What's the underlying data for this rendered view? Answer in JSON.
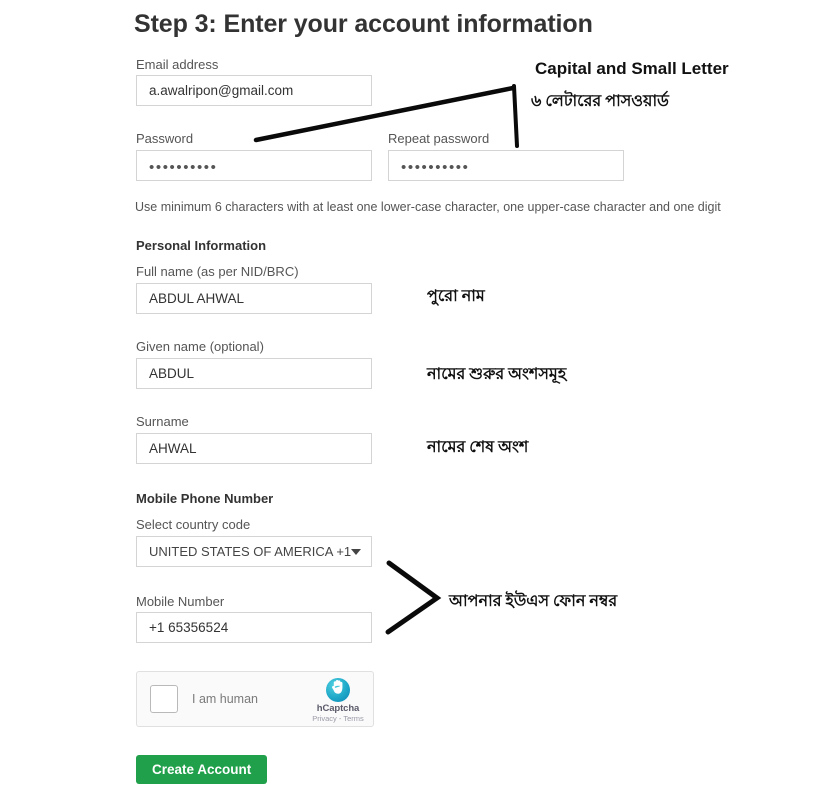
{
  "page": {
    "title": "Step 3: Enter your account information",
    "background": "#ffffff",
    "accent_green": "#21a04b"
  },
  "form": {
    "email": {
      "label": "Email address",
      "value": "a.awalripon@gmail.com",
      "placeholder": "Email address"
    },
    "password": {
      "label": "Password",
      "value": "••••••••••",
      "placeholder": "Password"
    },
    "repeat_password": {
      "label": "Repeat password",
      "value": "••••••••••",
      "placeholder": "Repeat password"
    },
    "password_helper": "Use minimum 6 characters with at least one lower-case character, one upper-case character and one digit",
    "personal_information": {
      "heading": "Personal Information",
      "full_name": {
        "label": "Full name (as per NID/BRC)",
        "value": "ABDUL AHWAL",
        "placeholder": "Full name"
      },
      "given_name": {
        "label": "Given name (optional)",
        "value": "ABDUL",
        "placeholder": "Given name"
      },
      "surname": {
        "label": "Surname",
        "value": "AHWAL",
        "placeholder": "Surname"
      }
    },
    "mobile_phone": {
      "heading": "Mobile Phone Number",
      "country_code": {
        "label": "Select country code",
        "value": "UNITED STATES OF AMERICA +1",
        "caret_icon": "chevron-down-icon"
      },
      "mobile_number": {
        "label": "Mobile Number",
        "value": "+1 65356524",
        "placeholder": "Mobile Number"
      }
    },
    "captcha": {
      "checkbox_label": "I am human",
      "brand": "hCaptcha",
      "links": "Privacy - Terms",
      "logo_icon": "hcaptcha-hand-icon"
    },
    "submit": {
      "label": "Create Account"
    }
  },
  "annotations": {
    "password_rule_en": "Capital and Small Letter",
    "password_rule_bn": "৬ লেটারের পাসওয়ার্ড",
    "full_name_bn": "পুরো নাম",
    "given_name_bn": "নামের শুরুর অংশসমূহ",
    "surname_bn": "নামের শেষ অংশ",
    "mobile_bn": "আপনার ইউএস ফোন নম্বর"
  }
}
